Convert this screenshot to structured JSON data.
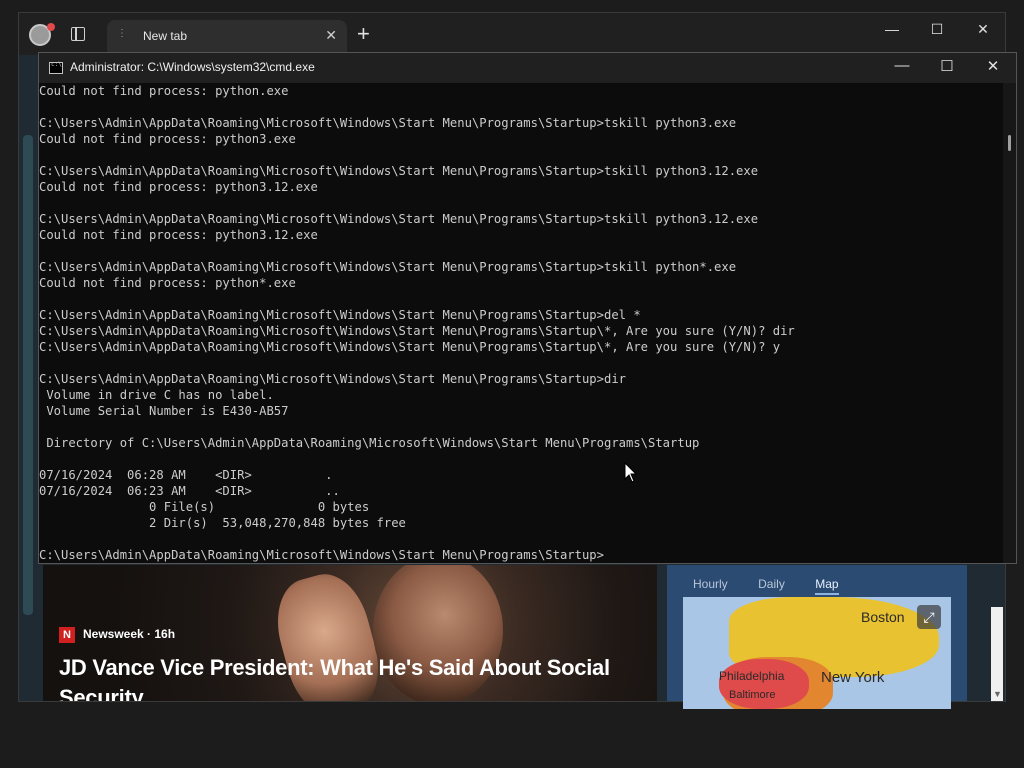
{
  "browser": {
    "tab_title": "New tab",
    "tab_close": "✕",
    "new_tab": "+",
    "window_controls": {
      "minimize": "—",
      "maximize": "☐",
      "close": "✕"
    }
  },
  "news": {
    "source_logo": "N",
    "source": "Newsweek · 16h",
    "headline": "JD Vance Vice President: What He's Said About Social Security"
  },
  "weather": {
    "tabs": [
      "Hourly",
      "Daily",
      "Map"
    ],
    "active_tab": "Map",
    "cities": [
      "Boston",
      "Philadelphia",
      "Baltimore",
      "New York"
    ],
    "expand": "⤢"
  },
  "cmd": {
    "title": "Administrator: C:\\Windows\\system32\\cmd.exe",
    "window_controls": {
      "minimize": "—",
      "maximize": "☐",
      "close": "✕"
    },
    "lines": [
      "Could not find process: python.exe",
      "",
      "C:\\Users\\Admin\\AppData\\Roaming\\Microsoft\\Windows\\Start Menu\\Programs\\Startup>tskill python3.exe",
      "Could not find process: python3.exe",
      "",
      "C:\\Users\\Admin\\AppData\\Roaming\\Microsoft\\Windows\\Start Menu\\Programs\\Startup>tskill python3.12.exe",
      "Could not find process: python3.12.exe",
      "",
      "C:\\Users\\Admin\\AppData\\Roaming\\Microsoft\\Windows\\Start Menu\\Programs\\Startup>tskill python3.12.exe",
      "Could not find process: python3.12.exe",
      "",
      "C:\\Users\\Admin\\AppData\\Roaming\\Microsoft\\Windows\\Start Menu\\Programs\\Startup>tskill python*.exe",
      "Could not find process: python*.exe",
      "",
      "C:\\Users\\Admin\\AppData\\Roaming\\Microsoft\\Windows\\Start Menu\\Programs\\Startup>del *",
      "C:\\Users\\Admin\\AppData\\Roaming\\Microsoft\\Windows\\Start Menu\\Programs\\Startup\\*, Are you sure (Y/N)? dir",
      "C:\\Users\\Admin\\AppData\\Roaming\\Microsoft\\Windows\\Start Menu\\Programs\\Startup\\*, Are you sure (Y/N)? y",
      "",
      "C:\\Users\\Admin\\AppData\\Roaming\\Microsoft\\Windows\\Start Menu\\Programs\\Startup>dir",
      " Volume in drive C has no label.",
      " Volume Serial Number is E430-AB57",
      "",
      " Directory of C:\\Users\\Admin\\AppData\\Roaming\\Microsoft\\Windows\\Start Menu\\Programs\\Startup",
      "",
      "07/16/2024  06:28 AM    <DIR>          .",
      "07/16/2024  06:23 AM    <DIR>          ..",
      "               0 File(s)              0 bytes",
      "               2 Dir(s)  53,048,270,848 bytes free",
      "",
      "C:\\Users\\Admin\\AppData\\Roaming\\Microsoft\\Windows\\Start Menu\\Programs\\Startup>"
    ]
  }
}
